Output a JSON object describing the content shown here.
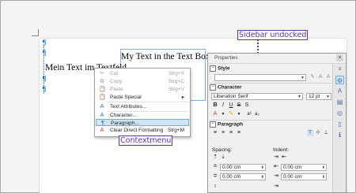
{
  "document": {
    "textbox_text": "My Text in the Text Box.",
    "body_text": "Mein Text im Textfeld",
    "pilcrow": "¶"
  },
  "callouts": {
    "sidebar": "Sidebar undocked",
    "contextmenu": "Contextmenu"
  },
  "context_menu": {
    "items": [
      {
        "icon": "✂",
        "label": "Cut",
        "shortcut": "Strg+X",
        "disabled": true
      },
      {
        "icon": "⧉",
        "label": "Copy",
        "shortcut": "Strg+C",
        "disabled": true
      },
      {
        "icon": "📋",
        "label": "Paste",
        "shortcut": "Strg+V",
        "disabled": true
      },
      {
        "icon": "📋",
        "label": "Paste Special",
        "shortcut": "▸",
        "disabled": false
      },
      {
        "icon": "A",
        "label": "Text Attributes...",
        "shortcut": "",
        "disabled": false
      },
      {
        "icon": "A",
        "label": "Character...",
        "shortcut": "",
        "disabled": false
      },
      {
        "icon": "¶",
        "label": "Paragraph...",
        "shortcut": "",
        "disabled": false,
        "selected": true
      },
      {
        "icon": "A",
        "label": "Clear Direct Formatting",
        "shortcut": "Strg+M",
        "disabled": false
      }
    ]
  },
  "sidebar": {
    "title": "Properties",
    "close": "×",
    "sections": {
      "style": "Style",
      "character": "Character",
      "paragraph": "Paragraph"
    },
    "font_name": "Liberation Serif",
    "font_size": "12 pt",
    "char_buttons": [
      "B",
      "I",
      "U",
      "S",
      "S"
    ],
    "spacing_label": "Spacing:",
    "indent_label": "Indent:",
    "spacing_values": [
      "0.00 cm",
      "0.00 cm"
    ],
    "indent_values": [
      "0.00 cm",
      "0.00 cm"
    ]
  }
}
